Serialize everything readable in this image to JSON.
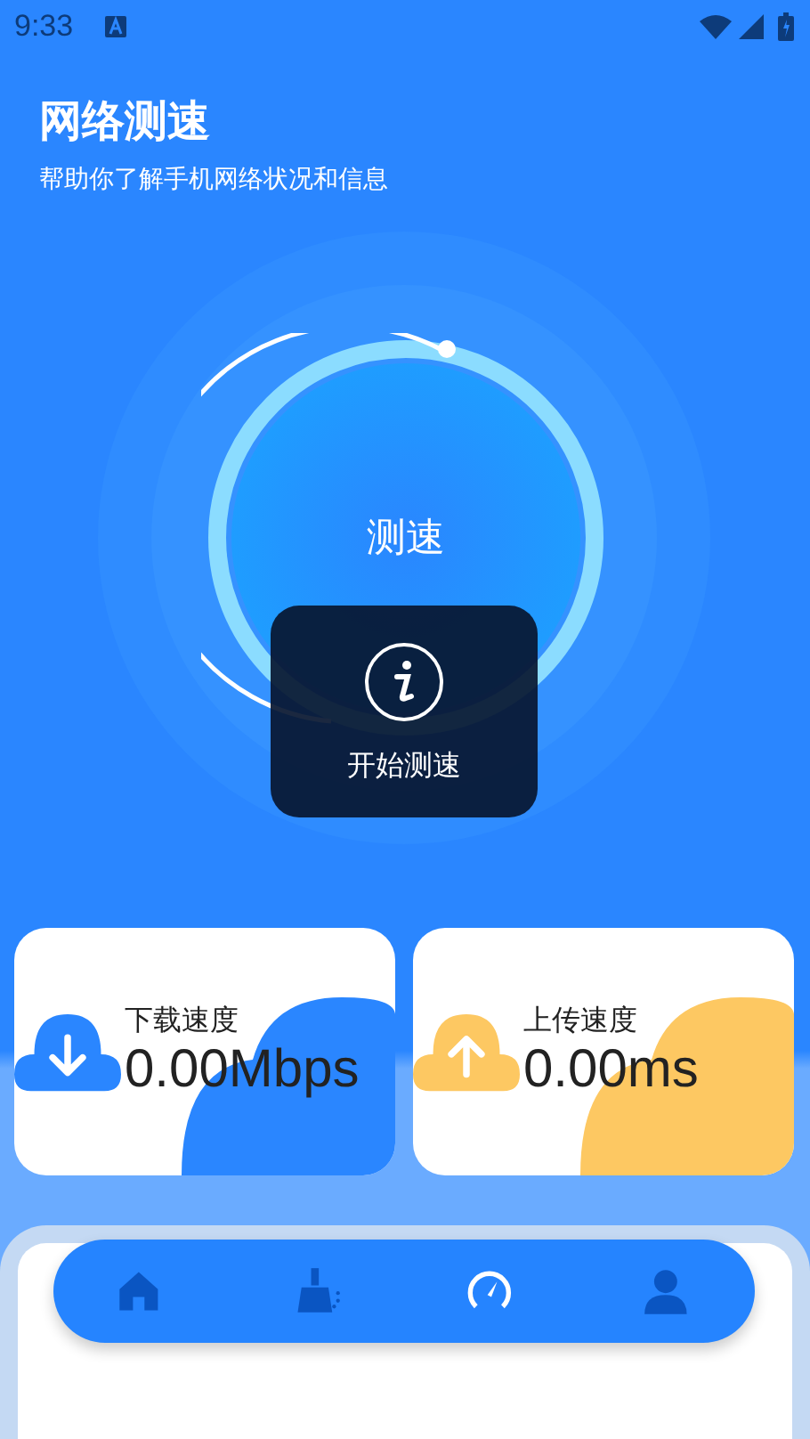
{
  "status_bar": {
    "time": "9:33"
  },
  "header": {
    "title": "网络测速",
    "subtitle": "帮助你了解手机网络状况和信息"
  },
  "dial": {
    "label": "测速"
  },
  "toast": {
    "text": "开始测速"
  },
  "cards": [
    {
      "kind": "download",
      "label": "下载速度",
      "value": "0.00Mbps"
    },
    {
      "kind": "upload",
      "label": "上传速度",
      "value": "0.00ms"
    }
  ],
  "nav": [
    {
      "kind": "home",
      "selected": false
    },
    {
      "kind": "clean",
      "selected": false
    },
    {
      "kind": "speed",
      "selected": true
    },
    {
      "kind": "profile",
      "selected": false
    }
  ]
}
